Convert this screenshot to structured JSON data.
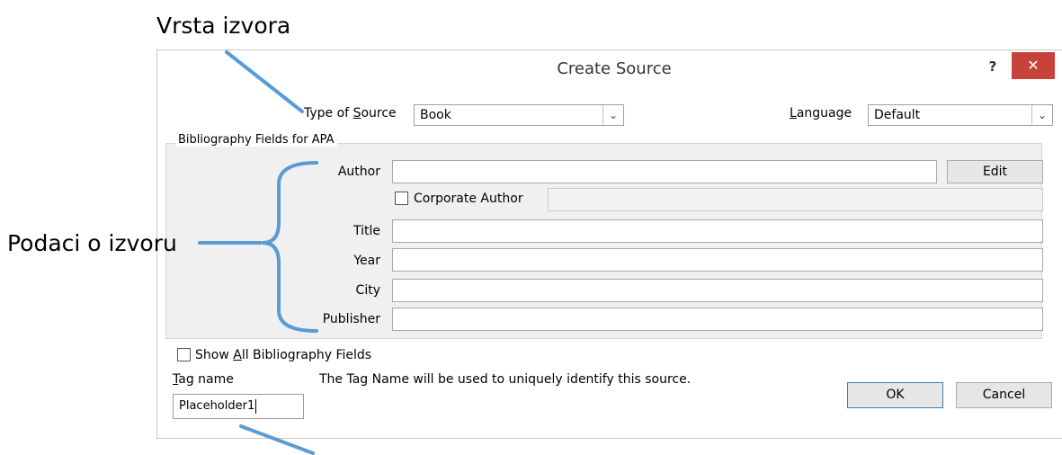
{
  "annotations": {
    "source_type_caption": "Vrsta izvora",
    "source_data_caption": "Podaci o izvoru"
  },
  "dialog": {
    "title": "Create Source",
    "help_label": "?",
    "close_label": "✕",
    "type_of_source": {
      "label_pre": "Type of ",
      "label_key": "S",
      "label_post": "ource",
      "value": "Book"
    },
    "language": {
      "label_key": "L",
      "label_post": "anguage",
      "value": "Default"
    },
    "group_title": "Bibliography Fields for APA",
    "fields": {
      "author_label": "Author",
      "edit_label": "Edit",
      "corporate_author_label": "Corporate Author",
      "title_label": "Title",
      "year_label": "Year",
      "city_label": "City",
      "publisher_label": "Publisher"
    },
    "show_all": {
      "pre": "Show ",
      "key": "A",
      "post": "ll Bibliography Fields"
    },
    "tag_name": {
      "label_key": "T",
      "label_post": "ag name",
      "value": "Placeholder1"
    },
    "tag_hint": "The Tag Name will be used to uniquely identify this source.",
    "ok_label": "OK",
    "cancel_label": "Cancel"
  },
  "colors": {
    "close_button": "#c7423a",
    "annotation_lines": "#5b9bd5",
    "ok_border": "#3c7fb1"
  }
}
